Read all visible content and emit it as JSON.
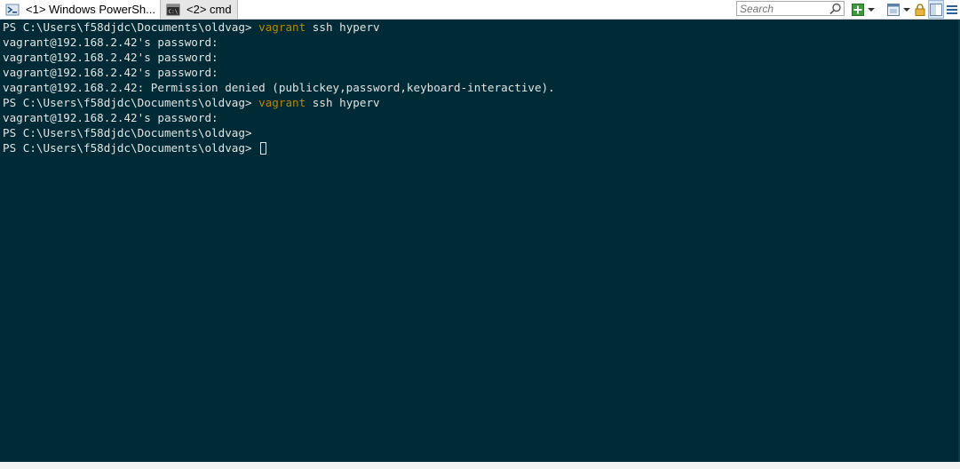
{
  "tabs": [
    {
      "label": "<1> Windows PowerSh...",
      "icon": "powershell-icon",
      "active": true
    },
    {
      "label": "<2> cmd",
      "icon": "cmd-icon",
      "active": false
    }
  ],
  "search": {
    "placeholder": "Search"
  },
  "toolbar": {
    "icons": [
      "search-icon",
      "add-console-icon",
      "dropdown-arrow-icon",
      "window-layout-icon",
      "dropdown-arrow-icon",
      "lock-icon",
      "split-view-icon",
      "menu-icon"
    ]
  },
  "console": {
    "lines": [
      {
        "prompt": "PS C:\\Users\\f58djdc\\Documents\\oldvag> ",
        "cmd": "vagrant",
        "args": " ssh hyperv"
      },
      {
        "text": "vagrant@192.168.2.42's password:"
      },
      {
        "text": "vagrant@192.168.2.42's password:"
      },
      {
        "text": "vagrant@192.168.2.42's password:"
      },
      {
        "text": "vagrant@192.168.2.42: Permission denied (publickey,password,keyboard-interactive)."
      },
      {
        "prompt": "PS C:\\Users\\f58djdc\\Documents\\oldvag> ",
        "cmd": "vagrant",
        "args": " ssh hyperv"
      },
      {
        "text": "vagrant@192.168.2.42's password:"
      },
      {
        "text": "PS C:\\Users\\f58djdc\\Documents\\oldvag>"
      },
      {
        "text": "PS C:\\Users\\f58djdc\\Documents\\oldvag> "
      }
    ]
  },
  "colors": {
    "background": "#002b36",
    "foreground": "#e3e3e3",
    "command": "#b58900"
  }
}
